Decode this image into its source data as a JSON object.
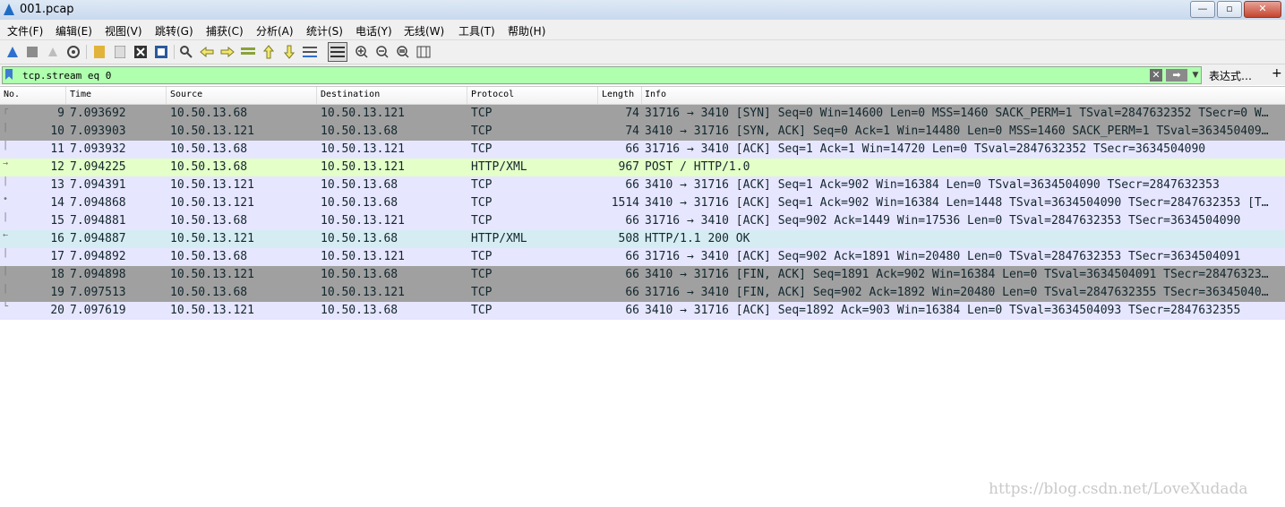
{
  "window": {
    "title": "001.pcap",
    "minimize": "—",
    "maximize": "▫",
    "close": "✕"
  },
  "menu": [
    {
      "label": "文件(F)"
    },
    {
      "label": "编辑(E)"
    },
    {
      "label": "视图(V)"
    },
    {
      "label": "跳转(G)"
    },
    {
      "label": "捕获(C)"
    },
    {
      "label": "分析(A)"
    },
    {
      "label": "统计(S)"
    },
    {
      "label": "电话(Y)"
    },
    {
      "label": "无线(W)"
    },
    {
      "label": "工具(T)"
    },
    {
      "label": "帮助(H)"
    }
  ],
  "toolbar": {
    "icons": [
      "shark-fin-start-icon",
      "stop-capture-icon",
      "restart-capture-icon",
      "capture-options-icon",
      "open-file-icon",
      "save-file-icon",
      "close-file-icon",
      "reload-file-icon",
      "find-packet-icon",
      "go-back-icon",
      "go-forward-icon",
      "go-to-packet-icon",
      "go-first-icon",
      "go-last-icon",
      "autoscroll-icon",
      "colorize-icon",
      "zoom-in-icon",
      "zoom-out-icon",
      "zoom-normal-icon",
      "resize-columns-icon"
    ]
  },
  "filter": {
    "value": "tcp.stream eq 0",
    "expression_label": "表达式…",
    "plus_label": "+",
    "clear_glyph": "✕",
    "apply_glyph": "➡",
    "dropdown_glyph": "▼"
  },
  "columns": {
    "no": "No.",
    "time": "Time",
    "source": "Source",
    "destination": "Destination",
    "protocol": "Protocol",
    "length": "Length",
    "info": "Info"
  },
  "colors": {
    "tcp_flags": "#a0a0a0",
    "tcp": "#e7e6ff",
    "http_request": "#e4ffc7",
    "http_response_selected": "#d6ecf3",
    "text": "#12272e"
  },
  "packets": [
    {
      "no": "9",
      "time": "7.093692",
      "src": "10.50.13.68",
      "dst": "10.50.13.121",
      "proto": "TCP",
      "len": "74",
      "info": "31716 → 3410 [SYN] Seq=0 Win=14600 Len=0 MSS=1460 SACK_PERM=1 TSval=2847632352 TSecr=0 W…",
      "color": "#a0a0a0",
      "conv": "┌"
    },
    {
      "no": "10",
      "time": "7.093903",
      "src": "10.50.13.121",
      "dst": "10.50.13.68",
      "proto": "TCP",
      "len": "74",
      "info": "3410 → 31716 [SYN, ACK] Seq=0 Ack=1 Win=14480 Len=0 MSS=1460 SACK_PERM=1 TSval=363450409…",
      "color": "#a0a0a0",
      "conv": "│"
    },
    {
      "no": "11",
      "time": "7.093932",
      "src": "10.50.13.68",
      "dst": "10.50.13.121",
      "proto": "TCP",
      "len": "66",
      "info": "31716 → 3410 [ACK] Seq=1 Ack=1 Win=14720 Len=0 TSval=2847632352 TSecr=3634504090",
      "color": "#e7e6ff",
      "conv": "│"
    },
    {
      "no": "12",
      "time": "7.094225",
      "src": "10.50.13.68",
      "dst": "10.50.13.121",
      "proto": "HTTP/XML",
      "len": "967",
      "info": "POST / HTTP/1.0",
      "color": "#e4ffc7",
      "conv": "→"
    },
    {
      "no": "13",
      "time": "7.094391",
      "src": "10.50.13.121",
      "dst": "10.50.13.68",
      "proto": "TCP",
      "len": "66",
      "info": "3410 → 31716 [ACK] Seq=1 Ack=902 Win=16384 Len=0 TSval=3634504090 TSecr=2847632353",
      "color": "#e7e6ff",
      "conv": "│"
    },
    {
      "no": "14",
      "time": "7.094868",
      "src": "10.50.13.121",
      "dst": "10.50.13.68",
      "proto": "TCP",
      "len": "1514",
      "info": "3410 → 31716 [ACK] Seq=1 Ack=902 Win=16384 Len=1448 TSval=3634504090 TSecr=2847632353 [T…",
      "color": "#e7e6ff",
      "conv": "•"
    },
    {
      "no": "15",
      "time": "7.094881",
      "src": "10.50.13.68",
      "dst": "10.50.13.121",
      "proto": "TCP",
      "len": "66",
      "info": "31716 → 3410 [ACK] Seq=902 Ack=1449 Win=17536 Len=0 TSval=2847632353 TSecr=3634504090",
      "color": "#e7e6ff",
      "conv": "│"
    },
    {
      "no": "16",
      "time": "7.094887",
      "src": "10.50.13.121",
      "dst": "10.50.13.68",
      "proto": "HTTP/XML",
      "len": "508",
      "info": "HTTP/1.1 200 OK",
      "color": "#d6ecf3",
      "conv": "←"
    },
    {
      "no": "17",
      "time": "7.094892",
      "src": "10.50.13.68",
      "dst": "10.50.13.121",
      "proto": "TCP",
      "len": "66",
      "info": "31716 → 3410 [ACK] Seq=902 Ack=1891 Win=20480 Len=0 TSval=2847632353 TSecr=3634504091",
      "color": "#e7e6ff",
      "conv": "│"
    },
    {
      "no": "18",
      "time": "7.094898",
      "src": "10.50.13.121",
      "dst": "10.50.13.68",
      "proto": "TCP",
      "len": "66",
      "info": "3410 → 31716 [FIN, ACK] Seq=1891 Ack=902 Win=16384 Len=0 TSval=3634504091 TSecr=28476323…",
      "color": "#a0a0a0",
      "conv": "│"
    },
    {
      "no": "19",
      "time": "7.097513",
      "src": "10.50.13.68",
      "dst": "10.50.13.121",
      "proto": "TCP",
      "len": "66",
      "info": "31716 → 3410 [FIN, ACK] Seq=902 Ack=1892 Win=20480 Len=0 TSval=2847632355 TSecr=36345040…",
      "color": "#a0a0a0",
      "conv": "│"
    },
    {
      "no": "20",
      "time": "7.097619",
      "src": "10.50.13.121",
      "dst": "10.50.13.68",
      "proto": "TCP",
      "len": "66",
      "info": "3410 → 31716 [ACK] Seq=1892 Ack=903 Win=16384 Len=0 TSval=3634504093 TSecr=2847632355",
      "color": "#e7e6ff",
      "conv": "└"
    }
  ],
  "watermark": "https://blog.csdn.net/LoveXudada"
}
